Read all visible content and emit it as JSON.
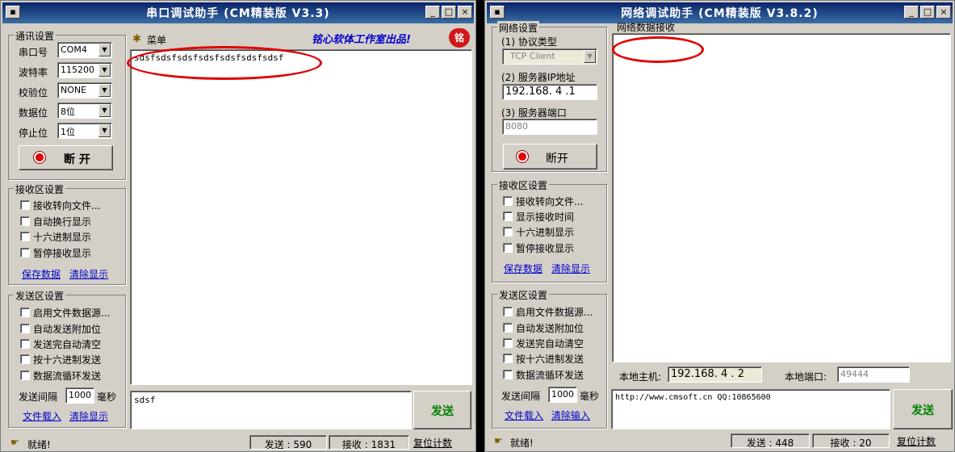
{
  "serial": {
    "title": "串口调试助手 (CM精装版 V3.3)",
    "comm_group": "通讯设置",
    "port_label": "串口号",
    "port_value": "COM4",
    "baud_label": "波特率",
    "baud_value": "115200",
    "parity_label": "校验位",
    "parity_value": "NONE",
    "data_label": "数据位",
    "data_value": "8位",
    "stop_label": "停止位",
    "stop_value": "1位",
    "disconnect": "断 开",
    "menu": "菜单",
    "banner": "铭心软体工作室出品!",
    "banner_badge": "铭",
    "recv_group": "接收区设置",
    "recv_opts": [
      "接收转向文件...",
      "自动换行显示",
      "十六进制显示",
      "暂停接收显示"
    ],
    "save_data": "保存数据",
    "clear_display": "清除显示",
    "send_group": "发送区设置",
    "send_opts": [
      "启用文件数据源...",
      "自动发送附加位",
      "发送完自动清空",
      "按十六进制发送",
      "数据流循环发送"
    ],
    "interval_label": "发送间隔",
    "interval_value": "1000",
    "interval_unit": "毫秒",
    "file_load": "文件载入",
    "clear_send": "清除显示",
    "recv_text": "sdsfsdsfsdsfsdsfsdsfsdsfsdsf",
    "send_text": "sdsf",
    "send_btn": "发送",
    "status_ready": "就绪!",
    "status_sent": "发送 : 590",
    "status_recv": "接收 : 1831",
    "reset_count": "复位计数"
  },
  "network": {
    "title": "网络调试助手 (CM精装版 V3.8.2)",
    "net_group": "网络设置",
    "proto_label": "(1) 协议类型",
    "proto_value": "TCP Client",
    "ip_label": "(2) 服务器IP地址",
    "ip_value": "192.168. 4 .1",
    "port_label": "(3) 服务器端口",
    "port_value": "8080",
    "disconnect": "断开",
    "recv_area_label": "网络数据接收",
    "recv_group": "接收区设置",
    "recv_opts": [
      "接收转向文件...",
      "显示接收时间",
      "十六进制显示",
      "暂停接收显示"
    ],
    "save_data": "保存数据",
    "clear_display": "清除显示",
    "send_group": "发送区设置",
    "send_opts": [
      "启用文件数据源...",
      "自动发送附加位",
      "发送完自动清空",
      "按十六进制发送",
      "数据流循环发送"
    ],
    "interval_label": "发送间隔",
    "interval_value": "1000",
    "interval_unit": "毫秒",
    "file_load": "文件载入",
    "clear_input": "清除输入",
    "local_host_label": "本地主机:",
    "local_host_value": "192.168. 4 . 2",
    "local_port_label": "本地端口:",
    "local_port_value": "49444",
    "send_text": "http://www.cmsoft.cn QQ:10865600",
    "send_btn": "发送",
    "status_ready": "就绪!",
    "status_sent": "发送 : 448",
    "status_recv": "接收 : 20",
    "reset_count": "复位计数"
  },
  "colors": {
    "accent": "#e00000",
    "link": "#0000cc",
    "title_bar": "#0a246a"
  }
}
